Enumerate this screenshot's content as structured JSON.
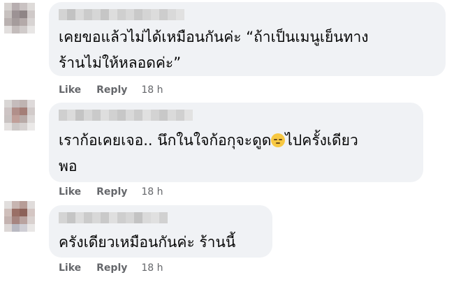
{
  "comments": [
    {
      "text_lines": [
        "เคยขอแล้วไม่ได้เหมือนกันค่ะ “ถ้าเป็นเมนูเย็นทาง",
        "ร้านไม่ให้หลอดค่ะ”"
      ],
      "like_label": "Like",
      "reply_label": "Reply",
      "time": "18 h"
    },
    {
      "text_lines": [
        "เราก้อเคยเจอ.. นึกในใจก้อกุจะดูด",
        "ไปครั้งเดียว",
        "พอ"
      ],
      "emoji": "pensive-face",
      "like_label": "Like",
      "reply_label": "Reply",
      "time": "18 h"
    },
    {
      "text_lines": [
        "ครังเดียวเหมือนกันค่ะ ร้านนี้"
      ],
      "like_label": "Like",
      "reply_label": "Reply",
      "time": "18 h"
    }
  ]
}
